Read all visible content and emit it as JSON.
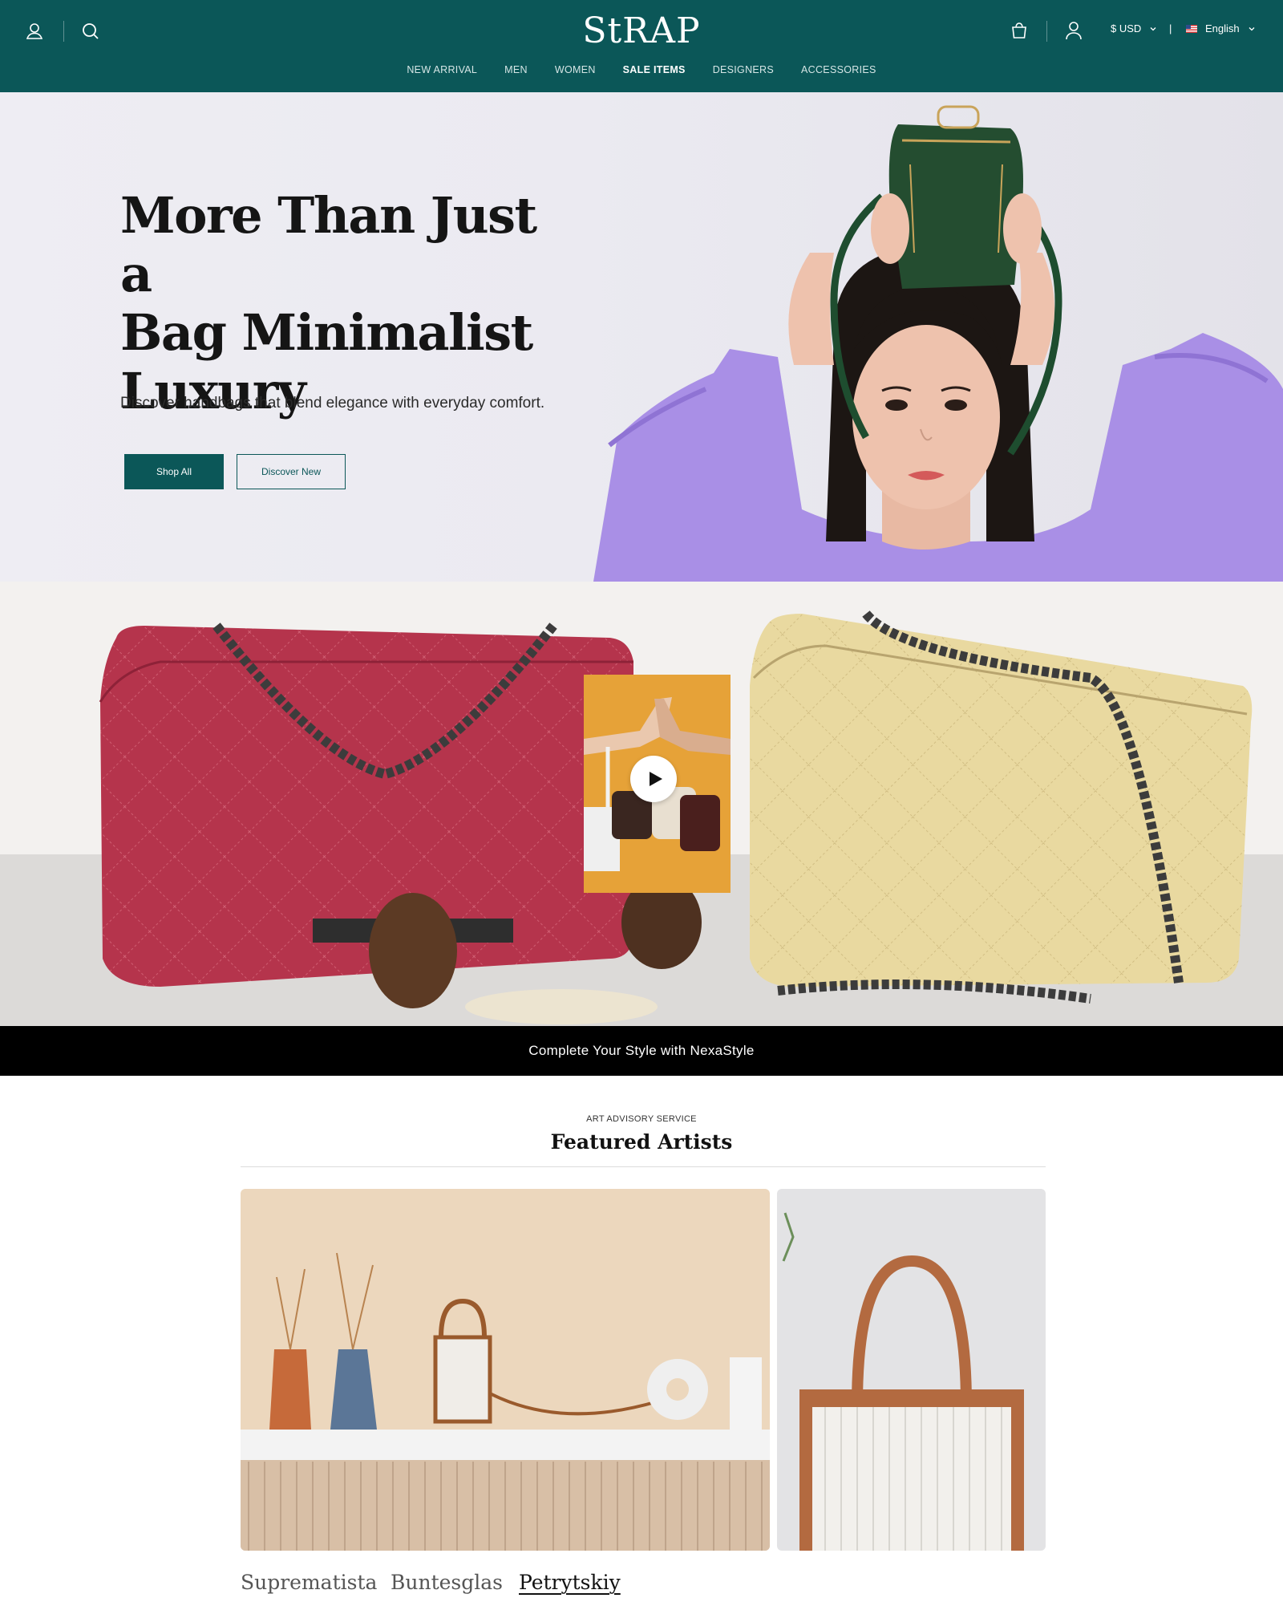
{
  "colors": {
    "brand_teal": "#0b5758",
    "strip_black": "#000000"
  },
  "header": {
    "logo_text": "StRAP",
    "icons": [
      "user-icon",
      "search-icon",
      "bag-icon",
      "account-icon",
      "chevron-down-icon"
    ],
    "currency": "$ USD",
    "language": "English",
    "nav": [
      {
        "label": "NEW ARRIVAL",
        "active": false
      },
      {
        "label": "MEN",
        "active": false
      },
      {
        "label": "WOMEN",
        "active": false
      },
      {
        "label": "SALE ITEMS",
        "active": true
      },
      {
        "label": "DESIGNERS",
        "active": false
      },
      {
        "label": "ACCESSORIES",
        "active": false
      }
    ]
  },
  "hero": {
    "title_line1": "More Than Just a",
    "title_line2": "Bag Minimalist",
    "title_line3": "Luxury",
    "subtitle": "Discover handbags that blend elegance with everyday comfort.",
    "primary_button": "Shop All",
    "secondary_button": "Discover New"
  },
  "video_banner": {
    "play_icon": "play-icon",
    "strip_text": "Complete Your Style with NexaStyle"
  },
  "featured": {
    "eyebrow": "ART ADVISORY SERVICE",
    "title": "Featured Artists",
    "tabs": [
      {
        "label": "Suprematista",
        "active": false
      },
      {
        "label": "Buntesglas",
        "active": false
      },
      {
        "label": "Petrytskiy",
        "active": true
      }
    ]
  }
}
